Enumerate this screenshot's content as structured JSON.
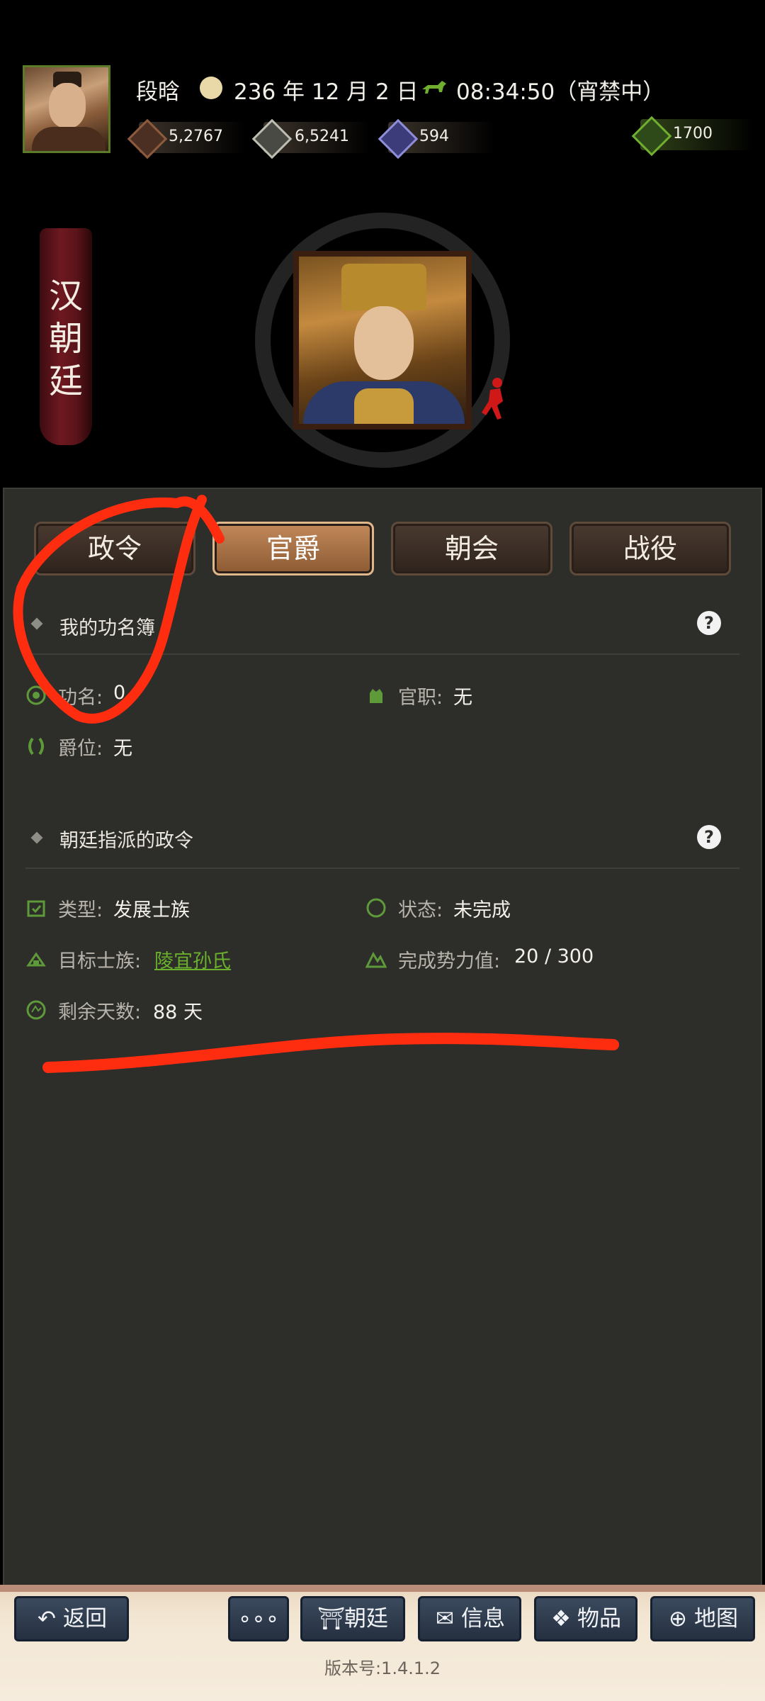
{
  "header": {
    "player_name": "段晗",
    "date": "236 年 12 月 2 日",
    "time": "08:34:50（宵禁中）",
    "resources": [
      {
        "name": "money",
        "icon": "coins-icon",
        "value": "5,2767"
      },
      {
        "name": "grain",
        "icon": "grain-icon",
        "value": "6,5241"
      },
      {
        "name": "troops",
        "icon": "soldier-icon",
        "value": "594"
      },
      {
        "name": "bag",
        "icon": "bag-icon",
        "value": "1700"
      }
    ]
  },
  "court": {
    "banner_chars": [
      "汉",
      "朝",
      "廷"
    ]
  },
  "tabs": [
    {
      "label": "政令",
      "active": false
    },
    {
      "label": "官爵",
      "active": true
    },
    {
      "label": "朝会",
      "active": false
    },
    {
      "label": "战役",
      "active": false
    }
  ],
  "section_rank": {
    "title": "我的功名簿",
    "fields": {
      "merit_label": "功名:",
      "merit_value": "0",
      "office_label": "官职:",
      "office_value": "无",
      "title_label": "爵位:",
      "title_value": "无"
    }
  },
  "section_decree": {
    "title": "朝廷指派的政令",
    "fields": {
      "type_label": "类型:",
      "type_value": "发展士族",
      "status_label": "状态:",
      "status_value": "未完成",
      "clan_label": "目标士族:",
      "clan_value": "陵宜孙氏",
      "progress_label": "完成势力值:",
      "progress_value": "20 / 300",
      "days_label": "剩余天数:",
      "days_value": "88 天"
    }
  },
  "bottom_nav": {
    "back": "返回",
    "more": "∘∘∘",
    "court": "朝廷",
    "info": "信息",
    "items": "物品",
    "map": "地图"
  },
  "version": "版本号:1.4.1.2",
  "colors": {
    "panel_bg": "#2d2d29",
    "active_tab": "#b47a4c",
    "link_green": "#69b12c",
    "annotation_red": "#ff2d10"
  }
}
